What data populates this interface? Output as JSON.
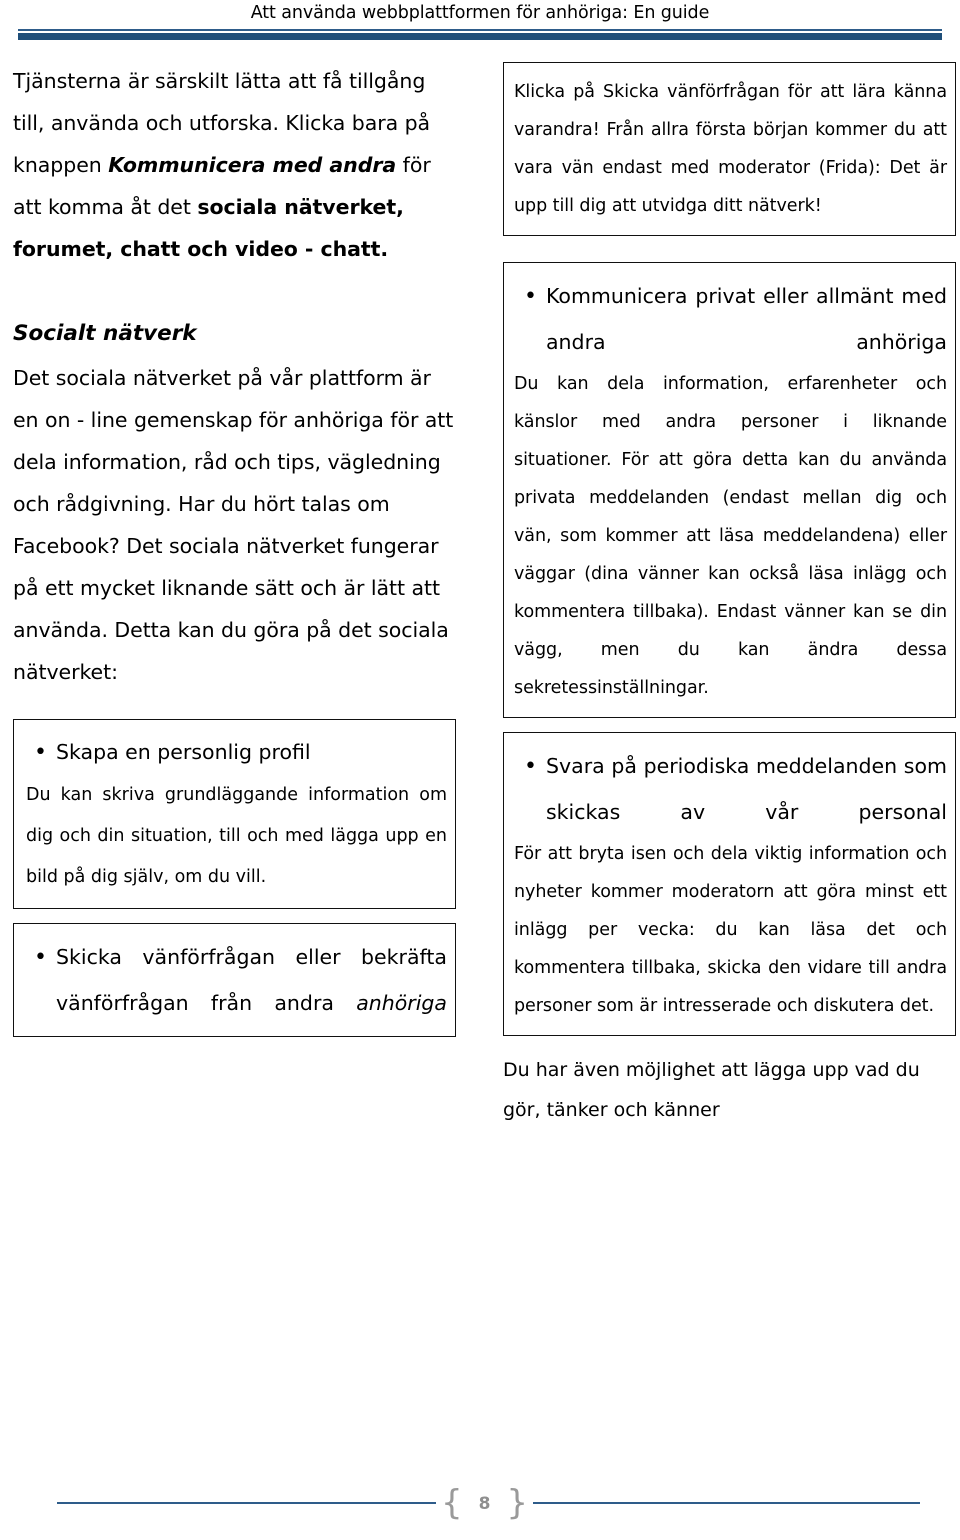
{
  "header": {
    "title": "Att använda webbplattformen för anhöriga: En guide",
    "rule_color": "#1F4E79"
  },
  "left_column": {
    "paragraph_1": {
      "seg_1": "Tjänsterna är särskilt lätta att få tillgång till, använda och utforska. Klicka bara på knappen ",
      "seg_2_bolditalic": "Kommunicera med andra",
      "seg_3": " för att komma åt det ",
      "seg_4_bold": "sociala nätverket, forumet, chatt och video - chatt."
    },
    "heading_1": "Socialt nätverk",
    "paragraph_2": "Det sociala nätverket på vår plattform är en on - line gemenskap för anhöriga för att dela information, råd och tips, vägledning och rådgivning. Har du hört talas om Facebook? Det sociala nätverket fungerar på ett mycket liknande sätt och är lätt att använda. Detta kan du göra på det sociala nätverket:",
    "boxes": [
      {
        "bullet": "•",
        "bullet_heading": "Skapa en personlig profil",
        "body": "Du kan skriva grundläggande information om dig och din situation, till och med lägga upp  en bild på dig själv, om du vill."
      },
      {
        "bullet": "•",
        "bullet_heading_seg_1": "Skicka vänförfrågan eller bekräfta vänförfrågan från andra ",
        "bullet_heading_seg_2_italic": "anhöriga"
      }
    ]
  },
  "right_column": {
    "box_1": {
      "text": "Klicka på Skicka vänförfrågan för att lära känna varandra! Från allra första början kommer du att vara vän endast med moderator (Frida): Det är upp till dig att utvidga ditt nätverk!"
    },
    "box_2": {
      "bullet": "•",
      "bullet_heading": "Kommunicera privat eller allmänt med andra anhöriga",
      "body": "Du kan dela information, erfarenheter och känslor med andra personer i liknande situationer. För att göra detta kan du använda privata meddelanden (endast mellan dig och vän, som kommer att läsa meddelandena) eller väggar (dina vänner kan också läsa inlägg och kommentera tillbaka). Endast vänner kan se din vägg, men du kan ändra dessa sekretessinställningar."
    },
    "box_3": {
      "bullet": "•",
      "bullet_heading": "Svara på periodiska meddelanden som skickas av vår personal",
      "body": "För att bryta isen och dela viktig information och nyheter kommer moderatorn att göra minst ett inlägg per vecka: du kan läsa det och kommentera tillbaka, skicka den vidare till andra personer som är intresserade och diskutera det."
    },
    "trailing_paragraph": "Du har även möjlighet att lägga upp vad du gör, tänker och känner"
  },
  "footer": {
    "page_number": "8",
    "brace_open": "{",
    "brace_close": "}",
    "rule_color": "#2E5C8A"
  }
}
